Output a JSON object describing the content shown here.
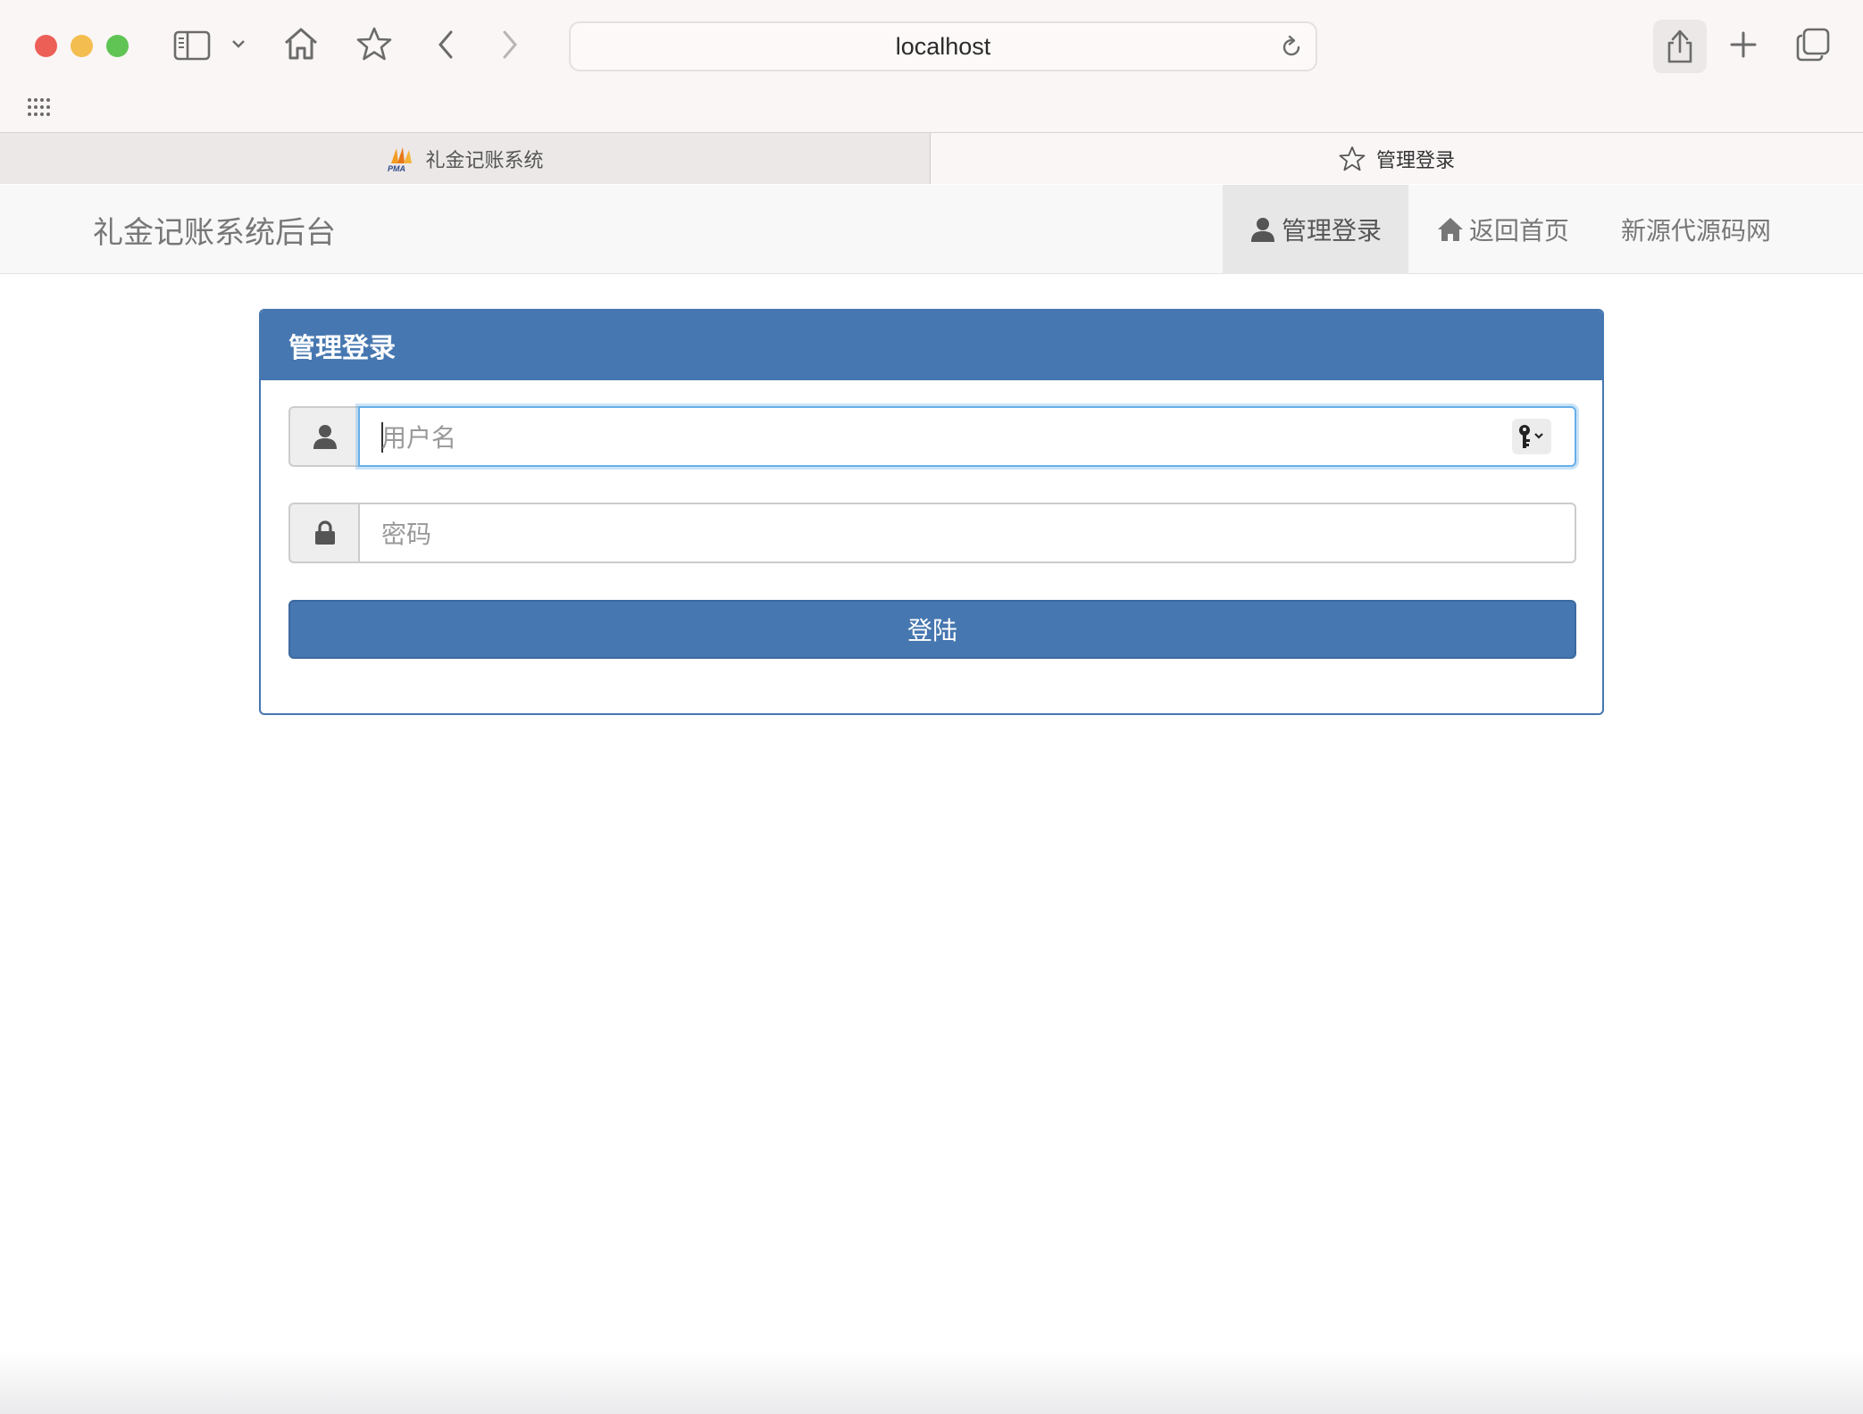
{
  "browser": {
    "url": "localhost",
    "tabs": [
      {
        "label": "礼金记账系统",
        "icon": "pma-logo-icon",
        "active": false
      },
      {
        "label": "管理登录",
        "icon": "star-icon",
        "active": true
      }
    ]
  },
  "navbar": {
    "brand": "礼金记账系统后台",
    "items": [
      {
        "label": "管理登录",
        "icon": "user-icon",
        "active": true
      },
      {
        "label": "返回首页",
        "icon": "home-icon",
        "active": false
      },
      {
        "label": "新源代源码网",
        "icon": "",
        "active": false
      }
    ]
  },
  "login": {
    "heading": "管理登录",
    "username_placeholder": "用户名",
    "password_placeholder": "密码",
    "submit_label": "登陆"
  },
  "colors": {
    "primary": "#4677b0",
    "focus": "#66afe9",
    "navbar_bg": "#f8f8f8"
  }
}
